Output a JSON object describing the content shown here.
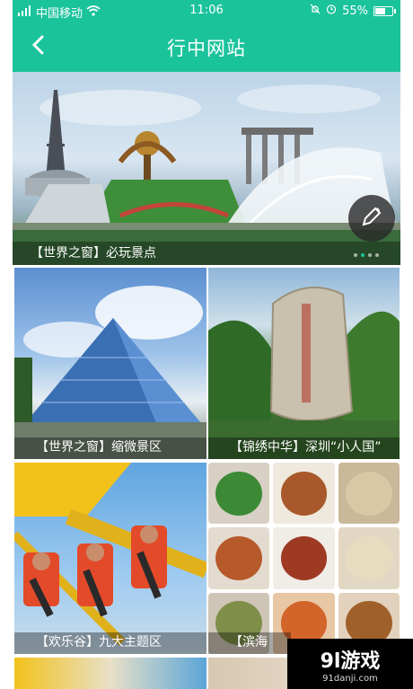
{
  "status_bar": {
    "carrier": "中国移动",
    "time": "11:06",
    "battery": "55%",
    "battery_level": 0.55
  },
  "header": {
    "title": "行中网站"
  },
  "hero": {
    "caption": "【世界之窗】必玩景点",
    "slide_count": 4,
    "active_slide": 1
  },
  "cards": [
    {
      "caption": "【世界之窗】缩微景区"
    },
    {
      "caption": "【锦绣中华】深圳“小人国”"
    },
    {
      "caption": "【欢乐谷】九大主题区"
    },
    {
      "caption": "【滨海"
    }
  ],
  "watermark": {
    "brand": "9l游戏",
    "url": "91danji.com"
  },
  "colors": {
    "accent": "#1bc39b"
  }
}
